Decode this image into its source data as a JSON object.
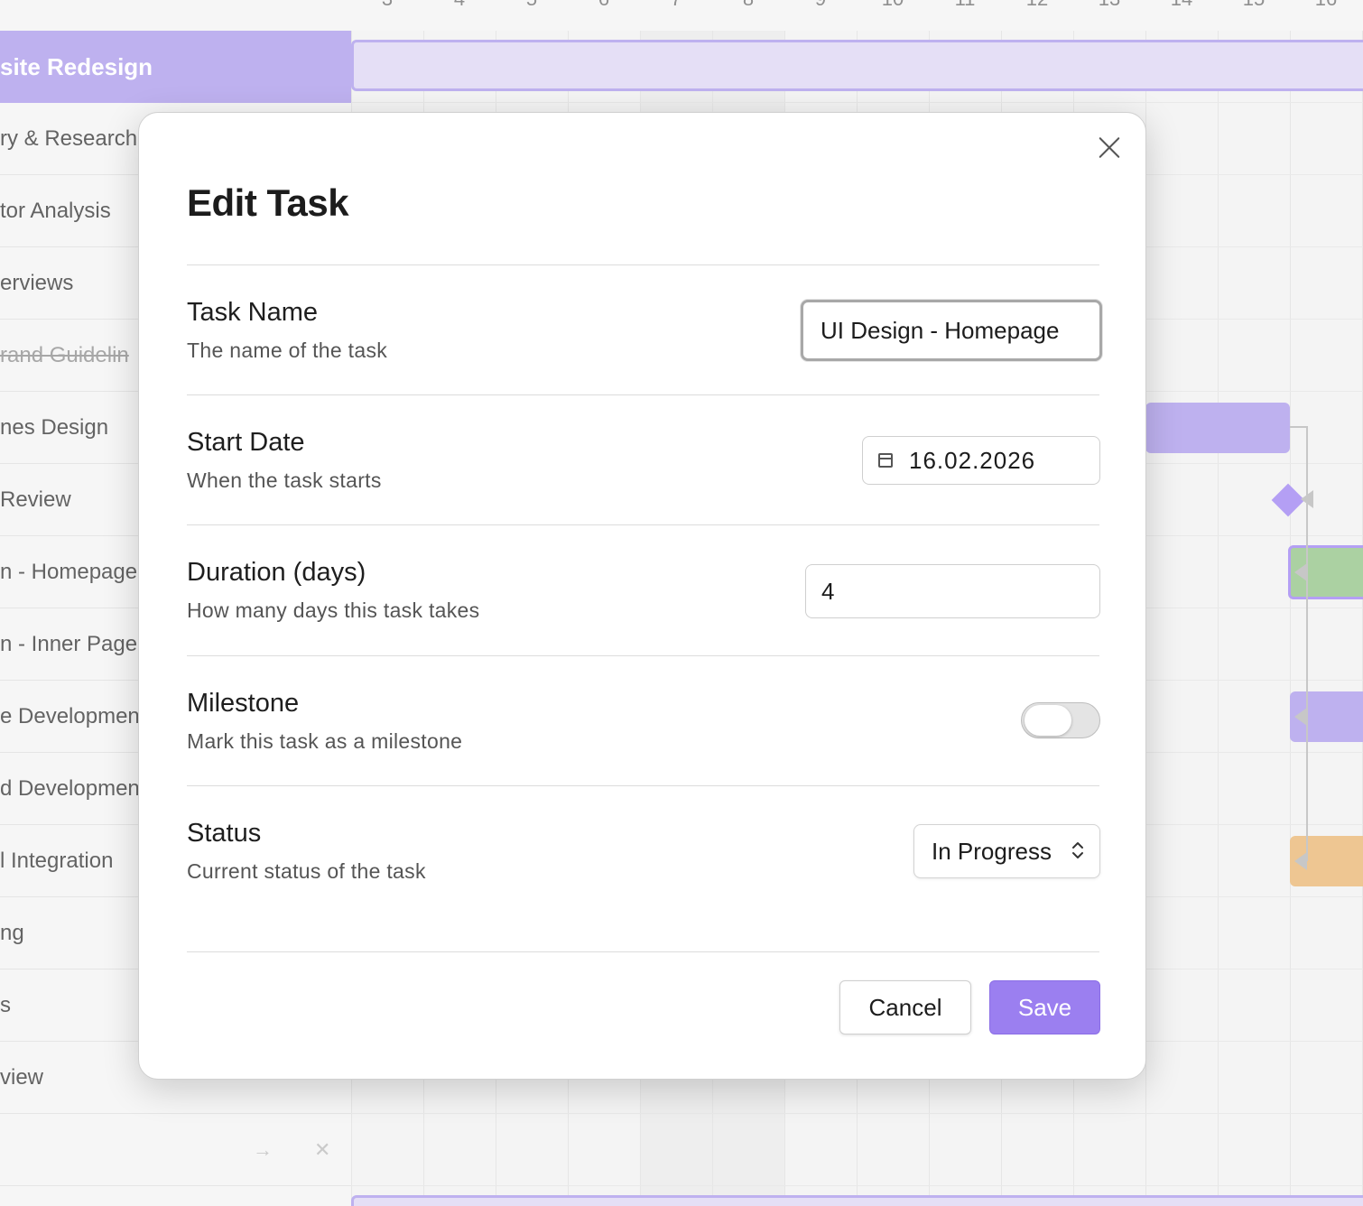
{
  "timeline": {
    "ticks": [
      "3",
      "4",
      "5",
      "6",
      "7",
      "8",
      "9",
      "10",
      "11",
      "12",
      "13",
      "14",
      "15",
      "16"
    ]
  },
  "tasks": [
    {
      "label": "site Redesign",
      "group": true
    },
    {
      "label": "ry & Research"
    },
    {
      "label": "tor Analysis"
    },
    {
      "label": "erviews"
    },
    {
      "label": "rand Guidelin",
      "strike": true
    },
    {
      "label": "nes Design"
    },
    {
      "label": "Review"
    },
    {
      "label": "n - Homepage"
    },
    {
      "label": "n - Inner Page"
    },
    {
      "label": "e Developmen"
    },
    {
      "label": "d Developmen"
    },
    {
      "label": "l Integration"
    },
    {
      "label": "ng"
    },
    {
      "label": "s"
    },
    {
      "label": "view"
    },
    {
      "label": ""
    }
  ],
  "row_actions": {
    "dependency_glyph": "→",
    "delete_glyph": "✕"
  },
  "colors": {
    "accent": "#9b7ff0",
    "group_bar": "#dcd4f3",
    "task_bar": "#a897ea",
    "done_bar": "#8fc283",
    "warning_bar": "#e9b36e"
  },
  "modal": {
    "title": "Edit Task",
    "fields": {
      "task_name": {
        "label": "Task Name",
        "description": "The name of the task",
        "value": "UI Design - Homepage"
      },
      "start_date": {
        "label": "Start Date",
        "description": "When the task starts",
        "value": "16.02.2026"
      },
      "duration": {
        "label": "Duration (days)",
        "description": "How many days this task takes",
        "value": "4"
      },
      "milestone": {
        "label": "Milestone",
        "description": "Mark this task as a milestone",
        "checked": false
      },
      "status": {
        "label": "Status",
        "description": "Current status of the task",
        "value": "In Progress"
      }
    },
    "buttons": {
      "cancel": "Cancel",
      "save": "Save"
    }
  }
}
